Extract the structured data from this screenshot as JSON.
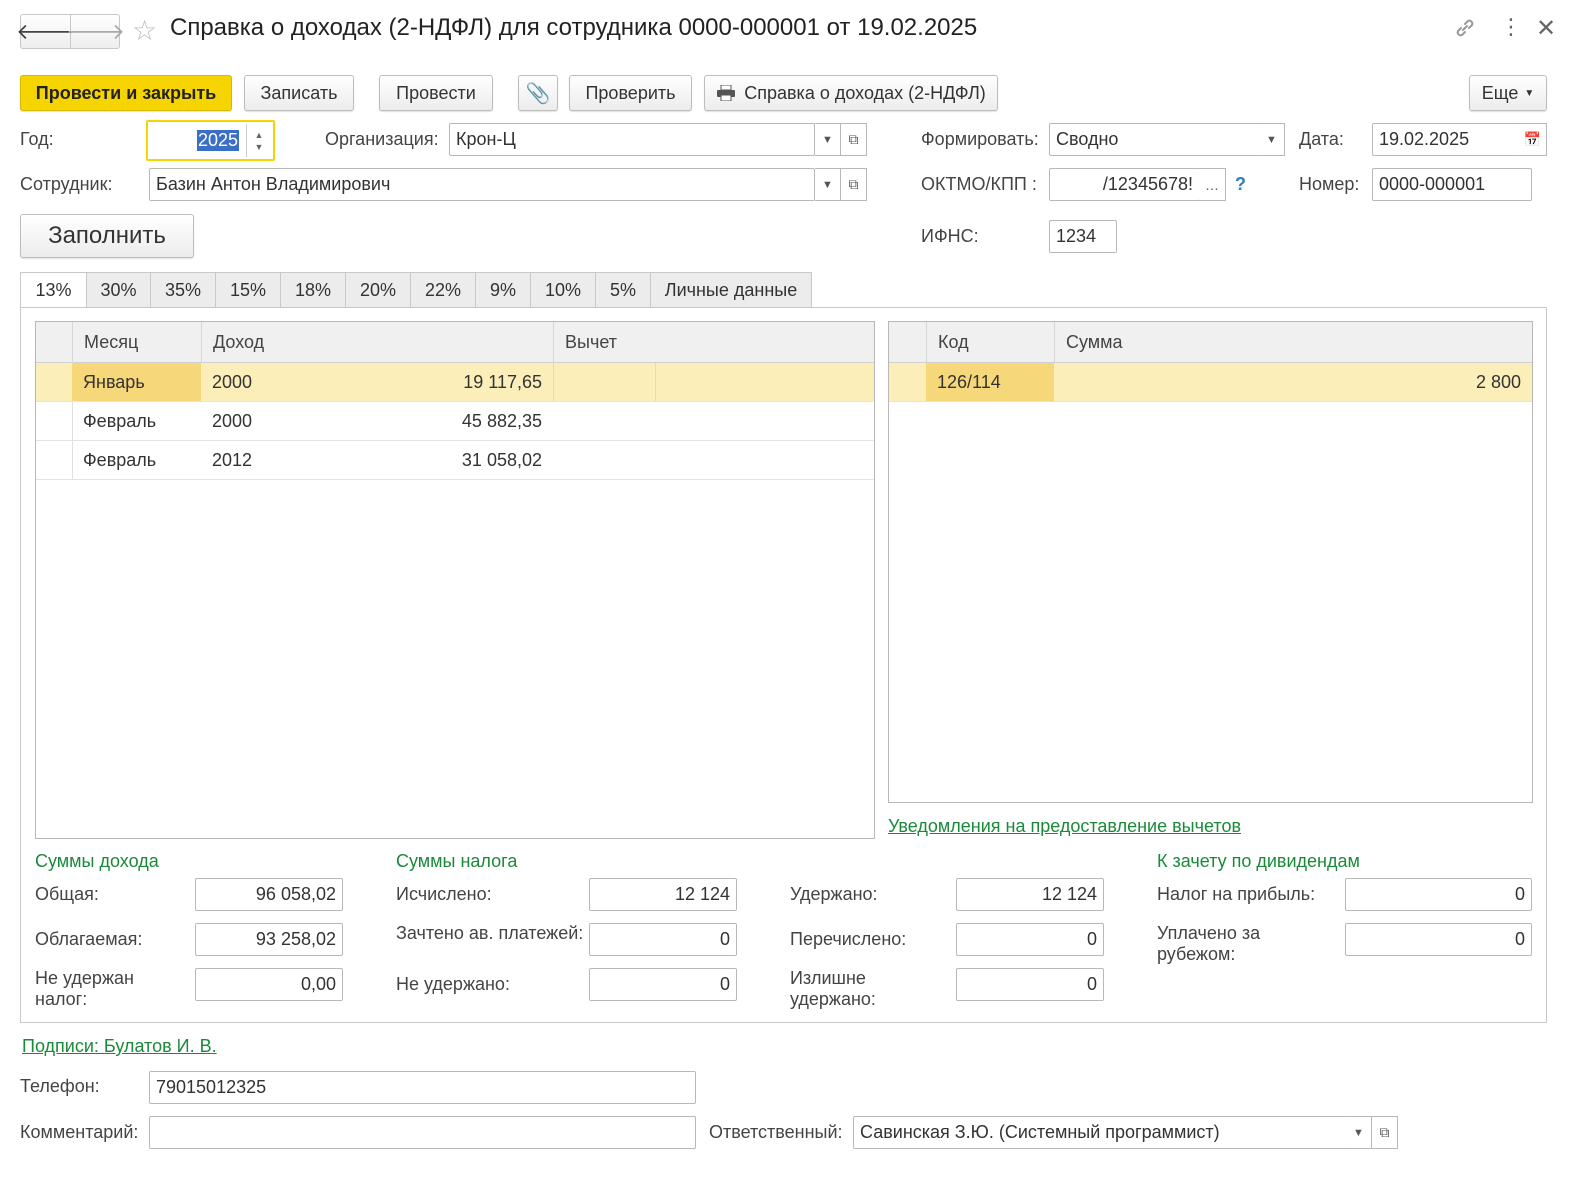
{
  "window": {
    "title": "Справка о доходах (2-НДФЛ) для сотрудника 0000-000001 от 19.02.2025"
  },
  "toolbar": {
    "post_close": "Провести и закрыть",
    "save": "Записать",
    "post": "Провести",
    "check": "Проверить",
    "print_report": "Справка о доходах (2-НДФЛ)",
    "more": "Еще"
  },
  "header": {
    "year_label": "Год:",
    "year_value": "2025",
    "org_label": "Организация:",
    "org_value": "Крон-Ц",
    "form_label": "Формировать:",
    "form_value": "Сводно",
    "date_label": "Дата:",
    "date_value": "19.02.2025",
    "employee_label": "Сотрудник:",
    "employee_value": "Базин Антон Владимирович",
    "oktmo_label": "ОКТМО/КПП :",
    "oktmo_value": "/12345678!",
    "number_label": "Номер:",
    "number_value": "0000-000001",
    "ifns_label": "ИФНС:",
    "ifns_value": "1234",
    "fill_button": "Заполнить"
  },
  "tabs": [
    "13%",
    "30%",
    "35%",
    "15%",
    "18%",
    "20%",
    "22%",
    "9%",
    "10%",
    "5%",
    "Личные данные"
  ],
  "income_table": {
    "columns": [
      "Месяц",
      "Доход",
      "Вычет"
    ],
    "rows": [
      {
        "month": "Январь",
        "code": "2000",
        "amount": "19 117,65"
      },
      {
        "month": "Февраль",
        "code": "2000",
        "amount": "45 882,35"
      },
      {
        "month": "Февраль",
        "code": "2012",
        "amount": "31 058,02"
      }
    ]
  },
  "deduction_table": {
    "columns": [
      "Код",
      "Сумма"
    ],
    "rows": [
      {
        "code": "126/114",
        "amount": "2 800"
      }
    ]
  },
  "deductions_link": "Уведомления на предоставление вычетов",
  "income_sums": {
    "title": "Суммы дохода",
    "total_label": "Общая:",
    "total_value": "96 058,02",
    "taxable_label": "Облагаемая:",
    "taxable_value": "93 258,02",
    "not_withheld_label": "Не удержан налог:",
    "not_withheld_value": "0,00"
  },
  "tax_sums": {
    "title": "Суммы налога",
    "calculated_label": "Исчислено:",
    "calculated_value": "12 124",
    "advance_label": "Зачтено ав. платежей:",
    "advance_value": "0",
    "not_withheld_label": "Не удержано:",
    "not_withheld_value": "0",
    "withheld_label": "Удержано:",
    "withheld_value": "12 124",
    "transferred_label": "Перечислено:",
    "transferred_value": "0",
    "excess_label": "Излишне удержано:",
    "excess_value": "0"
  },
  "dividends": {
    "title": "К зачету по дивидендам",
    "profit_tax_label": "Налог на прибыль:",
    "profit_tax_value": "0",
    "abroad_label": "Уплачено за рубежом:",
    "abroad_value": "0"
  },
  "footer": {
    "signatures_link": "Подписи: Булатов И. В.",
    "phone_label": "Телефон:",
    "phone_value": "79015012325",
    "comment_label": "Комментарий:",
    "comment_value": "",
    "responsible_label": "Ответственный:",
    "responsible_value": "Савинская З.Ю. (Системный программист)"
  },
  "colors": {
    "accent_yellow": "#f5d400",
    "link_green": "#1a8a3a",
    "selected_row": "#fbeeb8",
    "help_blue": "#2a7fc1"
  }
}
